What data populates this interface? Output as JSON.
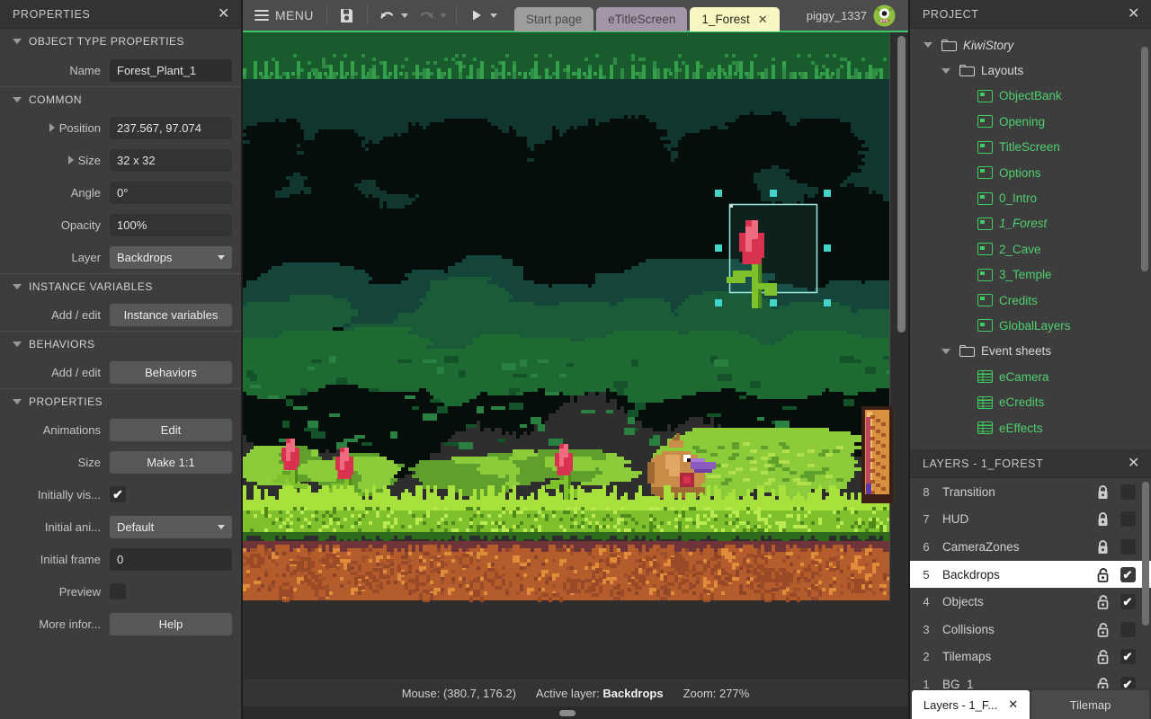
{
  "properties_panel": {
    "title": "PROPERTIES",
    "close_icon": "close-icon",
    "sections": [
      {
        "title": "OBJECT TYPE PROPERTIES",
        "rows": [
          {
            "label": "Name",
            "value": "Forest_Plant_1",
            "kind": "input"
          }
        ]
      },
      {
        "title": "COMMON",
        "rows": [
          {
            "label": "Position",
            "value": "237.567, 97.074",
            "kind": "input",
            "expander": "right"
          },
          {
            "label": "Size",
            "value": "32 x 32",
            "kind": "input",
            "expander": "right"
          },
          {
            "label": "Angle",
            "value": "0°",
            "kind": "input"
          },
          {
            "label": "Opacity",
            "value": "100%",
            "kind": "input"
          },
          {
            "label": "Layer",
            "value": "Backdrops",
            "kind": "dropdown"
          }
        ]
      },
      {
        "title": "INSTANCE VARIABLES",
        "rows": [
          {
            "label": "Add / edit",
            "value": "Instance variables",
            "kind": "button"
          }
        ]
      },
      {
        "title": "BEHAVIORS",
        "rows": [
          {
            "label": "Add / edit",
            "value": "Behaviors",
            "kind": "button"
          }
        ]
      },
      {
        "title": "PROPERTIES",
        "rows": [
          {
            "label": "Animations",
            "value": "Edit",
            "kind": "button"
          },
          {
            "label": "Size",
            "value": "Make 1:1",
            "kind": "button"
          },
          {
            "label": "Initially vis...",
            "value": "",
            "kind": "checkbox",
            "checked": true
          },
          {
            "label": "Initial ani...",
            "value": "Default",
            "kind": "dropdown"
          },
          {
            "label": "Initial frame",
            "value": "0",
            "kind": "input"
          },
          {
            "label": "Preview",
            "value": "",
            "kind": "checkbox",
            "checked": false
          },
          {
            "label": "More infor...",
            "value": "Help",
            "kind": "button"
          }
        ]
      }
    ]
  },
  "toolbar": {
    "menu_label": "MENU",
    "menu_icon": "hamburger-icon",
    "save_icon": "save-floppy-icon",
    "undo_icon": "undo-arrow-icon",
    "redo_icon": "redo-arrow-icon",
    "play_icon": "play-triangle-icon",
    "tabs": [
      {
        "label": "Start page",
        "state": "inactive",
        "color": "#9d9d9d",
        "text_color": "#4a4a4a",
        "closable": false
      },
      {
        "label": "eTitleScreen",
        "state": "inactive",
        "color": "#a396a6",
        "text_color": "#4a3f4c",
        "closable": false
      },
      {
        "label": "1_Forest",
        "state": "active",
        "color": "#f7f7c4",
        "text_color": "#2a2a1a",
        "closable": true,
        "close_label": "✕"
      }
    ],
    "user_name": "piggy_1337",
    "avatar_icon": "monster-avatar-icon"
  },
  "canvas": {
    "selected_object": "Forest_Plant_1",
    "selection_color": "#44d4c8",
    "scrollbar_vertical": "canvas-vertical-scrollbar",
    "scrollbar_horizontal": "canvas-horizontal-scrollbar"
  },
  "statusbar": {
    "mouse_label": "Mouse:",
    "mouse_value": "(380.7, 176.2)",
    "layer_label": "Active layer:",
    "layer_value": "Backdrops",
    "zoom_label": "Zoom:",
    "zoom_value": "277%"
  },
  "project_panel": {
    "title": "PROJECT",
    "close_icon": "close-icon",
    "tree": [
      {
        "label": "KiwiStory",
        "indent": 0,
        "icon": "folder-icon",
        "twisty": "down",
        "style": "white-italic"
      },
      {
        "label": "Layouts",
        "indent": 1,
        "icon": "folder-icon",
        "twisty": "down",
        "style": "white"
      },
      {
        "label": "ObjectBank",
        "indent": 2,
        "icon": "layout-icon",
        "twisty": "none",
        "style": "green"
      },
      {
        "label": "Opening",
        "indent": 2,
        "icon": "layout-icon",
        "twisty": "none",
        "style": "green"
      },
      {
        "label": "TitleScreen",
        "indent": 2,
        "icon": "layout-icon",
        "twisty": "none",
        "style": "green"
      },
      {
        "label": "Options",
        "indent": 2,
        "icon": "layout-icon",
        "twisty": "none",
        "style": "green"
      },
      {
        "label": "0_Intro",
        "indent": 2,
        "icon": "layout-icon",
        "twisty": "none",
        "style": "green"
      },
      {
        "label": "1_Forest",
        "indent": 2,
        "icon": "layout-icon",
        "twisty": "none",
        "style": "green-italic"
      },
      {
        "label": "2_Cave",
        "indent": 2,
        "icon": "layout-icon",
        "twisty": "none",
        "style": "green"
      },
      {
        "label": "3_Temple",
        "indent": 2,
        "icon": "layout-icon",
        "twisty": "none",
        "style": "green"
      },
      {
        "label": "Credits",
        "indent": 2,
        "icon": "layout-icon",
        "twisty": "none",
        "style": "green"
      },
      {
        "label": "GlobalLayers",
        "indent": 2,
        "icon": "layout-icon",
        "twisty": "none",
        "style": "green"
      },
      {
        "label": "Event sheets",
        "indent": 1,
        "icon": "folder-icon",
        "twisty": "down",
        "style": "white"
      },
      {
        "label": "eCamera",
        "indent": 2,
        "icon": "sheet-icon",
        "twisty": "none",
        "style": "green"
      },
      {
        "label": "eCredits",
        "indent": 2,
        "icon": "sheet-icon",
        "twisty": "none",
        "style": "green"
      },
      {
        "label": "eEffects",
        "indent": 2,
        "icon": "sheet-icon",
        "twisty": "none",
        "style": "green"
      }
    ]
  },
  "layers_panel": {
    "title": "LAYERS - 1_FOREST",
    "close_icon": "close-icon",
    "rows": [
      {
        "num": "8",
        "name": "Transition",
        "locked": true,
        "visible": false,
        "selected": false
      },
      {
        "num": "7",
        "name": "HUD",
        "locked": true,
        "visible": false,
        "selected": false
      },
      {
        "num": "6",
        "name": "CameraZones",
        "locked": true,
        "visible": false,
        "selected": false
      },
      {
        "num": "5",
        "name": "Backdrops",
        "locked": false,
        "visible": true,
        "selected": true
      },
      {
        "num": "4",
        "name": "Objects",
        "locked": false,
        "visible": true,
        "selected": false
      },
      {
        "num": "3",
        "name": "Collisions",
        "locked": false,
        "visible": false,
        "selected": false
      },
      {
        "num": "2",
        "name": "Tilemaps",
        "locked": false,
        "visible": true,
        "selected": false
      },
      {
        "num": "1",
        "name": "BG_1",
        "locked": false,
        "visible": true,
        "selected": false
      }
    ]
  },
  "bottom_tabs": [
    {
      "label": "Layers - 1_F...",
      "active": true,
      "closable": true,
      "close_label": "✕"
    },
    {
      "label": "Tilemap",
      "active": false,
      "closable": false
    }
  ]
}
